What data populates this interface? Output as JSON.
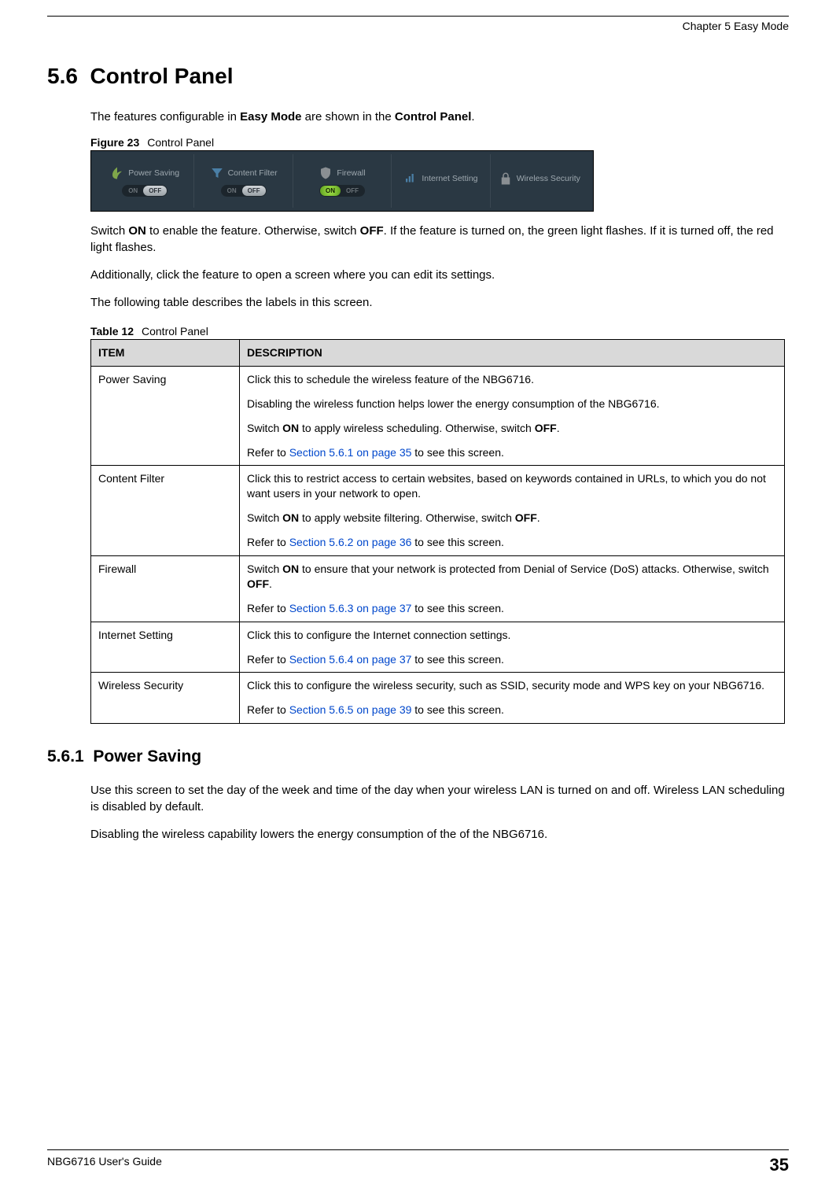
{
  "header": {
    "chapter": "Chapter 5 Easy Mode"
  },
  "section": {
    "number": "5.6",
    "title": "Control Panel",
    "intro_pre": "The features configurable in ",
    "intro_b1": "Easy Mode",
    "intro_mid": " are shown in the ",
    "intro_b2": "Control Panel",
    "intro_post": "."
  },
  "figure": {
    "label": "Figure 23",
    "caption": "Control Panel",
    "items": [
      {
        "label": "Power Saving",
        "icon": "leaf",
        "state": "off"
      },
      {
        "label": "Content Filter",
        "icon": "funnel",
        "state": "off"
      },
      {
        "label": "Firewall",
        "icon": "shield",
        "state": "on"
      },
      {
        "label": "Internet Setting",
        "icon": "bars",
        "state": "none"
      },
      {
        "label": "Wireless Security",
        "icon": "lock",
        "state": "none"
      }
    ],
    "on_text": "ON",
    "off_text": "OFF"
  },
  "para1": {
    "p1": "Switch ",
    "b1": "ON",
    "p2": " to enable the feature. Otherwise, switch ",
    "b2": "OFF",
    "p3": ". If the feature is turned on, the green light flashes. If it is turned off, the red light flashes."
  },
  "para2": "Additionally, click the feature to open a screen where you can edit its settings.",
  "para3": "The following table describes the labels in this screen.",
  "table": {
    "label": "Table 12",
    "caption": "Control Panel",
    "head_item": "ITEM",
    "head_desc": "DESCRIPTION",
    "rows": [
      {
        "item": "Power Saving",
        "d1": "Click this to schedule the wireless feature of the NBG6716.",
        "d2": "Disabling the wireless function helps lower the energy consumption of the NBG6716.",
        "d3_pre": "Switch ",
        "d3_b1": "ON",
        "d3_mid": " to apply wireless scheduling. Otherwise, switch ",
        "d3_b2": "OFF",
        "d3_post": ".",
        "d4_pre": "Refer to ",
        "d4_link": "Section 5.6.1 on page 35",
        "d4_post": " to see this screen."
      },
      {
        "item": "Content Filter",
        "d1": "Click this to restrict access to certain websites, based on keywords contained in URLs, to which you do not want users in your network to open.",
        "d3_pre": "Switch ",
        "d3_b1": "ON",
        "d3_mid": " to apply website filtering. Otherwise, switch ",
        "d3_b2": "OFF",
        "d3_post": ".",
        "d4_pre": "Refer to ",
        "d4_link": "Section 5.6.2 on page 36",
        "d4_post": " to see this screen."
      },
      {
        "item": "Firewall",
        "d3_pre": "Switch ",
        "d3_b1": "ON",
        "d3_mid": " to ensure that your network is protected from Denial of Service (DoS) attacks. Otherwise, switch ",
        "d3_b2": "OFF",
        "d3_post": ".",
        "d4_pre": "Refer to ",
        "d4_link": "Section 5.6.3 on page 37",
        "d4_post": " to see this screen."
      },
      {
        "item": "Internet Setting",
        "d1": "Click this to configure the Internet connection settings.",
        "d4_pre": "Refer to ",
        "d4_link": "Section 5.6.4 on page 37",
        "d4_post": " to see this screen."
      },
      {
        "item": "Wireless Security",
        "d1": "Click this to configure the wireless security, such as SSID, security mode and WPS key on your NBG6716.",
        "d4_pre": "Refer to ",
        "d4_link": "Section 5.6.5 on page 39",
        "d4_post": " to see this screen."
      }
    ]
  },
  "subsection": {
    "number": "5.6.1",
    "title": "Power Saving",
    "p1": "Use this screen to set the day of the week and time of the day when your wireless LAN is turned on and off. Wireless LAN scheduling is disabled by default.",
    "p2": "Disabling the wireless capability lowers the energy consumption of the of the NBG6716."
  },
  "footer": {
    "guide": "NBG6716 User's Guide",
    "page": "35"
  }
}
